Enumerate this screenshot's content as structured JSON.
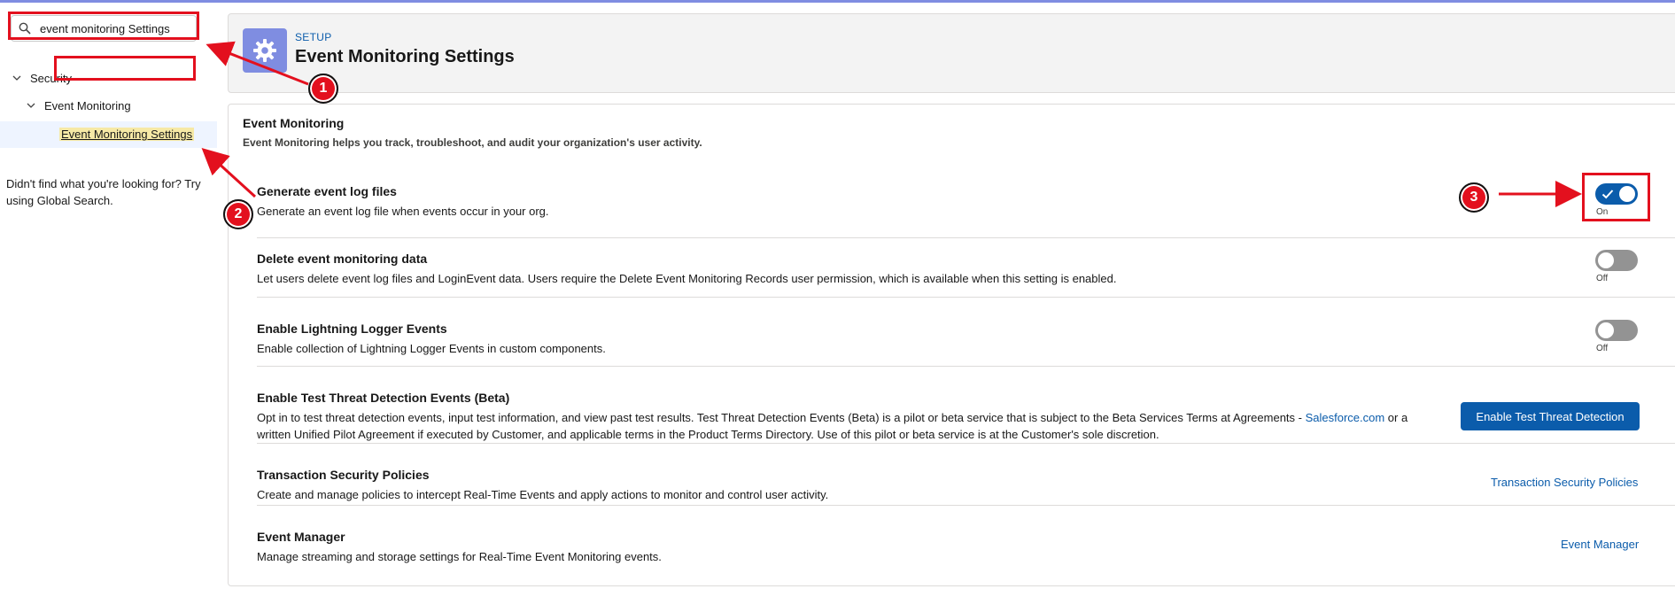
{
  "sidebar": {
    "search_value": "event monitoring Settings",
    "tree": {
      "security_label": "Security",
      "event_monitoring_label": "Event Monitoring",
      "settings_label": "Event Monitoring Settings"
    },
    "not_found_text": "Didn't find what you're looking for? Try using Global Search."
  },
  "header": {
    "eyebrow": "SETUP",
    "title": "Event Monitoring Settings"
  },
  "main": {
    "section_title": "Event Monitoring",
    "section_desc": "Event Monitoring helps you track, troubleshoot, and audit your organization's user activity.",
    "settings": [
      {
        "title": "Generate event log files",
        "desc": "Generate an event log file when events occur in your org.",
        "toggle_label": "On"
      },
      {
        "title": "Delete event monitoring data",
        "desc": "Let users delete event log files and LoginEvent data. Users require the Delete Event Monitoring Records user permission, which is available when this setting is enabled.",
        "toggle_label": "Off"
      },
      {
        "title": "Enable Lightning Logger Events",
        "desc": "Enable collection of Lightning Logger Events in custom components.",
        "toggle_label": "Off"
      },
      {
        "title": "Enable Test Threat Detection Events (Beta)",
        "desc_part1": "Opt in to test threat detection events, input test information, and view past test results. Test Threat Detection Events (Beta) is a pilot or beta service that is subject to the Beta Services Terms at Agreements - ",
        "desc_link": "Salesforce.com",
        "desc_part2": " or a written Unified Pilot Agreement if executed by Customer, and applicable terms in the Product Terms Directory. Use of this pilot or beta service is at the Customer's sole discretion.",
        "button_label": "Enable Test Threat Detection"
      },
      {
        "title": "Transaction Security Policies",
        "desc": "Create and manage policies to intercept Real-Time Events and apply actions to monitor and control user activity.",
        "link_label": "Transaction Security Policies"
      },
      {
        "title": "Event Manager",
        "desc": "Manage streaming and storage settings for Real-Time Event Monitoring events.",
        "link_label": "Event Manager"
      }
    ]
  },
  "annotations": {
    "step1": "1",
    "step2": "2",
    "step3": "3",
    "highlight_color": "#e3101e"
  },
  "colors": {
    "brand_blue": "#0b5cab",
    "header_icon_bg": "#7f8de1",
    "toggle_off": "#939393"
  },
  "toggles": {
    "generate_event_log_files": true,
    "delete_event_monitoring_data": false,
    "enable_lightning_logger_events": false
  }
}
